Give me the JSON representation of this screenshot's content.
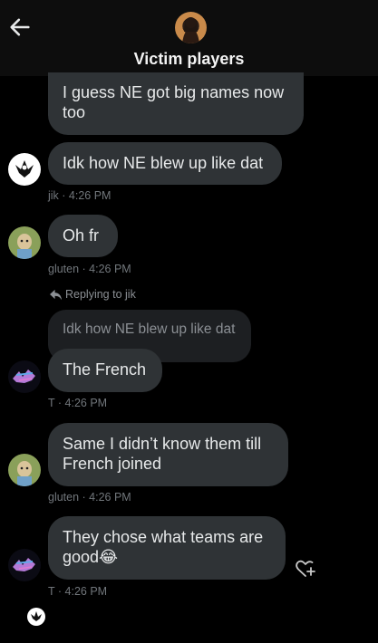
{
  "header": {
    "title": "Victim players",
    "back_icon": "arrow-left-icon",
    "avatar_icon": "group-avatar"
  },
  "messages": [
    {
      "text": "I guess NE got big names now too"
    },
    {
      "text": "Idk how NE blew up like dat",
      "sender": "jik",
      "time": "4:26 PM"
    },
    {
      "text": "Oh fr",
      "sender": "gluten",
      "time": "4:26 PM"
    },
    {
      "reply_label": "Replying to jik",
      "quoted_text": "Idk how NE blew up like dat",
      "text": "The French",
      "sender": "T",
      "time": "4:26 PM"
    },
    {
      "text": "Same I didn’t know them till French joined",
      "sender": "gluten",
      "time": "4:26 PM"
    },
    {
      "text": "They chose what teams are good😂",
      "sender": "T",
      "time": "4:26 PM"
    }
  ],
  "icons": {
    "reaction": "heart-plus-icon",
    "reply": "reply-arrow-icon",
    "bottom": "avatar-small-icon"
  },
  "colors": {
    "background": "#000000",
    "bubble": "#2f3336",
    "meta_text": "#71767b"
  }
}
